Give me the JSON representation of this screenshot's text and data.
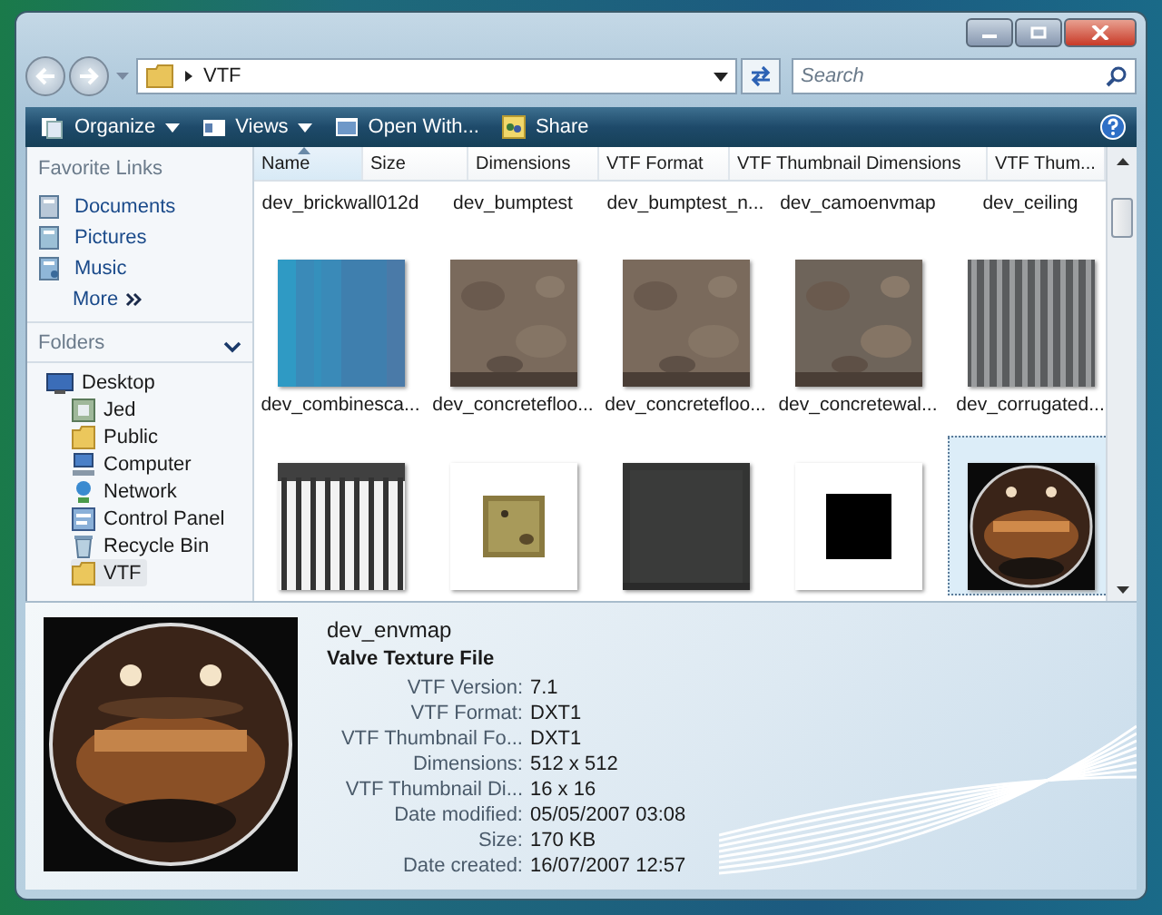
{
  "address": {
    "path": "VTF"
  },
  "search": {
    "placeholder": "Search"
  },
  "toolbar": [
    {
      "label": "Organize",
      "kind": "organize",
      "dropdown": true
    },
    {
      "label": "Views",
      "kind": "views",
      "dropdown": true
    },
    {
      "label": "Open With...",
      "kind": "open",
      "dropdown": false
    },
    {
      "label": "Share",
      "kind": "share",
      "dropdown": false
    }
  ],
  "favorite_links": {
    "title": "Favorite Links",
    "items": [
      {
        "label": "Documents",
        "kind": "documents"
      },
      {
        "label": "Pictures",
        "kind": "pictures"
      },
      {
        "label": "Music",
        "kind": "music"
      }
    ],
    "more": "More"
  },
  "folders": {
    "title": "Folders",
    "expanded": true,
    "tree": [
      {
        "label": "Desktop",
        "kind": "desktop",
        "selected": false,
        "children": [
          {
            "label": "Jed",
            "kind": "user",
            "selected": false
          },
          {
            "label": "Public",
            "kind": "folder",
            "selected": false
          },
          {
            "label": "Computer",
            "kind": "computer",
            "selected": false
          },
          {
            "label": "Network",
            "kind": "network",
            "selected": false
          },
          {
            "label": "Control Panel",
            "kind": "control",
            "selected": false
          },
          {
            "label": "Recycle Bin",
            "kind": "recycle",
            "selected": false
          },
          {
            "label": "VTF",
            "kind": "folder",
            "selected": true
          }
        ]
      }
    ]
  },
  "columns": [
    {
      "label": "Name",
      "sorted": true
    },
    {
      "label": "Size",
      "sorted": false
    },
    {
      "label": "Dimensions",
      "sorted": false
    },
    {
      "label": "VTF Format",
      "sorted": false
    },
    {
      "label": "VTF Thumbnail Dimensions",
      "sorted": false
    },
    {
      "label": "VTF Thum...",
      "sorted": false
    }
  ],
  "first_row_names": [
    "dev_brickwall012d",
    "dev_bumptest",
    "dev_bumptest_n...",
    "dev_camoenvmap",
    "dev_ceiling"
  ],
  "items": [
    {
      "name": "dev_combinesca...",
      "kind": "blue",
      "selected": false
    },
    {
      "name": "dev_concretefloo...",
      "kind": "concrete",
      "selected": false
    },
    {
      "name": "dev_concretefloo...",
      "kind": "concrete",
      "selected": false
    },
    {
      "name": "dev_concretewal...",
      "kind": "concretewall",
      "selected": false
    },
    {
      "name": "dev_corrugated...",
      "kind": "corrugated",
      "selected": false
    },
    {
      "kind": "bars",
      "selected": false
    },
    {
      "kind": "crate",
      "selected": false
    },
    {
      "kind": "panel",
      "selected": false
    },
    {
      "kind": "blackbox",
      "selected": false
    },
    {
      "kind": "sphere",
      "selected": true
    }
  ],
  "details": {
    "name": "dev_envmap",
    "type": "Valve Texture File",
    "properties": [
      {
        "label": "VTF Version:",
        "value": "7.1"
      },
      {
        "label": "VTF Format:",
        "value": "DXT1"
      },
      {
        "label": "VTF Thumbnail Fo...",
        "value": "DXT1"
      },
      {
        "label": "Dimensions:",
        "value": "512 x 512"
      },
      {
        "label": "VTF Thumbnail Di...",
        "value": "16 x 16"
      },
      {
        "label": "Date modified:",
        "value": "05/05/2007 03:08"
      },
      {
        "label": "Size:",
        "value": "170 KB"
      },
      {
        "label": "Date created:",
        "value": "16/07/2007 12:57"
      }
    ]
  }
}
